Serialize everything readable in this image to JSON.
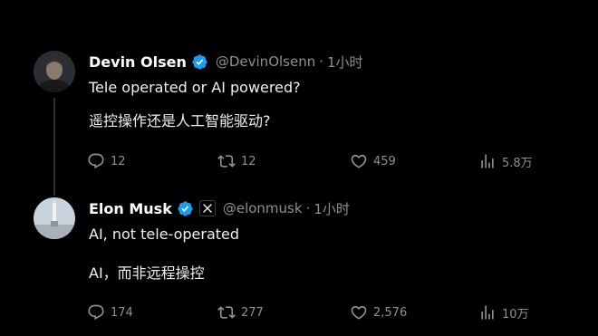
{
  "tweets": [
    {
      "name": "Devin Olsen",
      "handle": "@DevinOlsenn",
      "separator": "·",
      "time": "1小时",
      "verified": true,
      "affiliation_badge": false,
      "text_lines": [
        "Tele operated or AI powered?",
        "遥控操作还是人工智能驱动?"
      ],
      "actions": {
        "replies": "12",
        "reposts": "12",
        "likes": "459",
        "views": "5.8万"
      }
    },
    {
      "name": "Elon Musk",
      "handle": "@elonmusk",
      "separator": "·",
      "time": "1小时",
      "verified": true,
      "affiliation_badge": true,
      "affiliation_badge_text": "X",
      "text_lines": [
        "AI, not tele-operated",
        "AI，而非远程操控"
      ],
      "actions": {
        "replies": "174",
        "reposts": "277",
        "likes": "2,576",
        "views": "10万"
      }
    }
  ],
  "icons": {
    "reply": "reply-bubble-icon",
    "repost": "repost-arrows-icon",
    "like": "heart-icon",
    "views": "bar-chart-views-icon",
    "verified": "verified-badge-icon"
  },
  "colors": {
    "background": "#000000",
    "text": "#e7e9ea",
    "secondary": "#8b9096",
    "verified": "#1d9bf0"
  }
}
